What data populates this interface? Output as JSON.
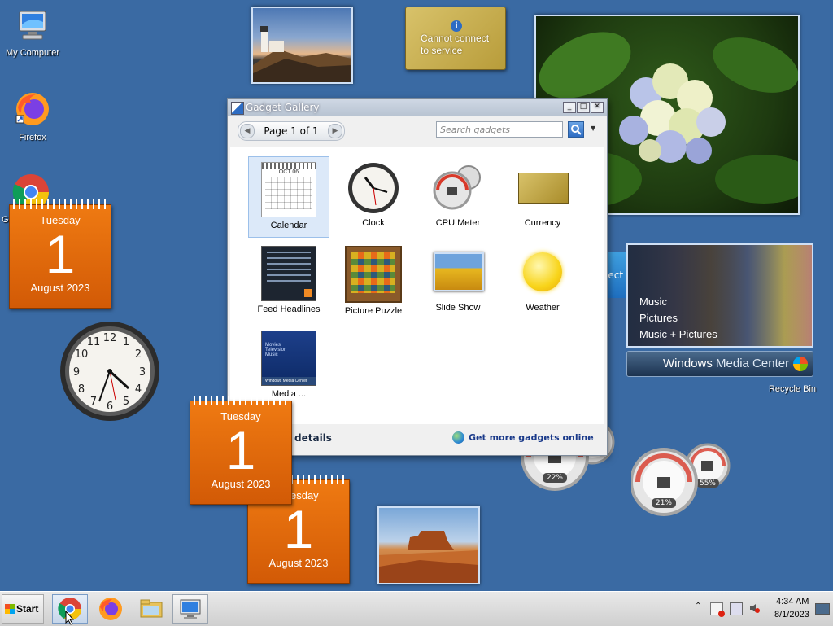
{
  "desktop": {
    "icons": [
      {
        "label": "My Computer"
      },
      {
        "label": "Firefox"
      },
      {
        "label": "Go"
      },
      {
        "label": "Recycle Bin"
      }
    ]
  },
  "calendars": [
    {
      "dow": "Tuesday",
      "day": "1",
      "month_year": "August 2023"
    },
    {
      "dow": "Tuesday",
      "day": "1",
      "month_year": "August 2023"
    },
    {
      "dow": "Tuesday",
      "day": "1",
      "month_year": "August 2023"
    }
  ],
  "currency_gadget": {
    "message": "Cannot connect to service"
  },
  "media_center": {
    "menu": [
      "Music",
      "Pictures",
      "Music + Pictures"
    ],
    "brand_bold": "Windows",
    "brand_rest": "Media Center",
    "partial_text": "lect"
  },
  "cpu_meters": [
    {
      "value": "22%"
    },
    {
      "value": "21%"
    },
    {
      "value": "55%"
    }
  ],
  "gallery": {
    "title": "Gadget Gallery",
    "page_label": "Page 1 of 1",
    "search_placeholder": "Search gadgets",
    "items": [
      {
        "label": "Calendar",
        "icon": "calendar-icon"
      },
      {
        "label": "Clock",
        "icon": "clock-icon"
      },
      {
        "label": "CPU Meter",
        "icon": "cpu-meter-icon"
      },
      {
        "label": "Currency",
        "icon": "currency-icon"
      },
      {
        "label": "Feed Headlines",
        "icon": "feed-icon"
      },
      {
        "label": "Picture Puzzle",
        "icon": "puzzle-icon"
      },
      {
        "label": "Slide Show",
        "icon": "slideshow-icon"
      },
      {
        "label": "Weather",
        "icon": "weather-icon"
      },
      {
        "label": "Media ...",
        "icon": "media-center-icon"
      }
    ],
    "calendar_thumb_month": "OCT 06",
    "media_thumb_lines": [
      "Movies",
      "Television",
      "Music"
    ],
    "media_thumb_bar": "Windows Media Center",
    "details_label": "details",
    "more_online": "Get more gadgets online"
  },
  "taskbar": {
    "start_label": "Start",
    "time": "4:34 AM",
    "date": "8/1/2023"
  }
}
